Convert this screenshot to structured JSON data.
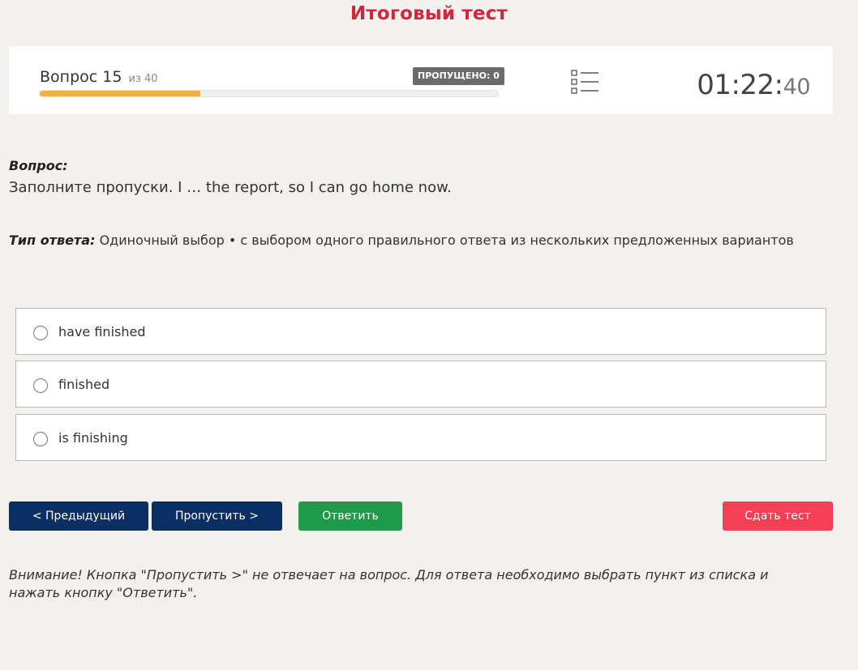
{
  "page": {
    "title": "Итоговый тест"
  },
  "header": {
    "question_word": "Вопрос",
    "question_number": "15",
    "question_total": "из 40",
    "skipped_badge": "ПРОПУЩЕНО: 0",
    "progress_fraction": 0.35,
    "list_icon": "list-icon",
    "timer_main": "01:22:",
    "timer_seconds": "40"
  },
  "question": {
    "label": "Вопрос:",
    "text": "Заполните пропуски. I … the report, so I can go home now."
  },
  "answer_type": {
    "label": "Тип ответа:",
    "text": "Одиночный выбор • с выбором одного правильного ответа из нескольких предложенных вариантов"
  },
  "options": [
    {
      "label": "have finished",
      "selected": false
    },
    {
      "label": "finished",
      "selected": false
    },
    {
      "label": "is finishing",
      "selected": false
    }
  ],
  "buttons": {
    "prev": "< Предыдущий",
    "skip": "Пропустить >",
    "answer": "Ответить",
    "submit": "Сдать тест"
  },
  "colors": {
    "title": "#d0273e",
    "progress": "#f0b142",
    "nav_button": "#0b2f63",
    "answer_button": "#1e9a4b",
    "submit_button": "#f43f54"
  },
  "notice": "Внимание! Кнопка \"Пропустить >\" не отвечает на вопрос. Для ответа необходимо выбрать пункт из списка и нажать кнопку \"Ответить\"."
}
